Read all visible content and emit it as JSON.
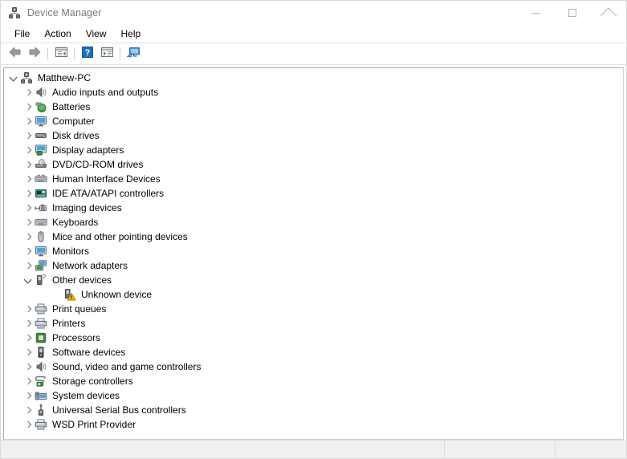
{
  "window": {
    "title": "Device Manager",
    "icon": "device-manager-icon",
    "controls": {
      "minimize": "minimize-button",
      "maximize": "maximize-button",
      "close": "close-button"
    }
  },
  "menubar": {
    "items": [
      {
        "label": "File",
        "name": "menu-file"
      },
      {
        "label": "Action",
        "name": "menu-action"
      },
      {
        "label": "View",
        "name": "menu-view"
      },
      {
        "label": "Help",
        "name": "menu-help"
      }
    ]
  },
  "toolbar": {
    "buttons": [
      {
        "name": "back-icon",
        "title": "Back"
      },
      {
        "name": "forward-icon",
        "title": "Forward"
      },
      {
        "name": "properties-icon",
        "title": "Properties"
      },
      {
        "name": "help-icon",
        "title": "Help"
      },
      {
        "name": "show-hide-console-tree-icon",
        "title": "Show/Hide Console Tree"
      },
      {
        "name": "scan-for-hardware-changes-icon",
        "title": "Scan for hardware changes"
      }
    ]
  },
  "tree": {
    "nodes": [
      {
        "label": "Matthew-PC",
        "level": 0,
        "state": "expanded",
        "icon": "computer-node-icon"
      },
      {
        "label": "Audio inputs and outputs",
        "level": 1,
        "state": "collapsed",
        "icon": "speaker-icon"
      },
      {
        "label": "Batteries",
        "level": 1,
        "state": "collapsed",
        "icon": "battery-icon"
      },
      {
        "label": "Computer",
        "level": 1,
        "state": "collapsed",
        "icon": "monitor-icon"
      },
      {
        "label": "Disk drives",
        "level": 1,
        "state": "collapsed",
        "icon": "disk-drive-icon"
      },
      {
        "label": "Display adapters",
        "level": 1,
        "state": "collapsed",
        "icon": "display-adapter-icon"
      },
      {
        "label": "DVD/CD-ROM drives",
        "level": 1,
        "state": "collapsed",
        "icon": "optical-drive-icon"
      },
      {
        "label": "Human Interface Devices",
        "level": 1,
        "state": "collapsed",
        "icon": "hid-icon"
      },
      {
        "label": "IDE ATA/ATAPI controllers",
        "level": 1,
        "state": "collapsed",
        "icon": "ide-controller-icon"
      },
      {
        "label": "Imaging devices",
        "level": 1,
        "state": "collapsed",
        "icon": "imaging-device-icon"
      },
      {
        "label": "Keyboards",
        "level": 1,
        "state": "collapsed",
        "icon": "keyboard-icon"
      },
      {
        "label": "Mice and other pointing devices",
        "level": 1,
        "state": "collapsed",
        "icon": "mouse-icon"
      },
      {
        "label": "Monitors",
        "level": 1,
        "state": "collapsed",
        "icon": "monitor-icon"
      },
      {
        "label": "Network adapters",
        "level": 1,
        "state": "collapsed",
        "icon": "network-adapter-icon"
      },
      {
        "label": "Other devices",
        "level": 1,
        "state": "expanded",
        "icon": "unknown-device-icon"
      },
      {
        "label": "Unknown device",
        "level": 2,
        "state": "leaf",
        "icon": "unknown-device-warning-icon"
      },
      {
        "label": "Print queues",
        "level": 1,
        "state": "collapsed",
        "icon": "printer-icon"
      },
      {
        "label": "Printers",
        "level": 1,
        "state": "collapsed",
        "icon": "printer-icon"
      },
      {
        "label": "Processors",
        "level": 1,
        "state": "collapsed",
        "icon": "processor-icon"
      },
      {
        "label": "Software devices",
        "level": 1,
        "state": "collapsed",
        "icon": "software-device-icon"
      },
      {
        "label": "Sound, video and game controllers",
        "level": 1,
        "state": "collapsed",
        "icon": "speaker-icon"
      },
      {
        "label": "Storage controllers",
        "level": 1,
        "state": "collapsed",
        "icon": "storage-controller-icon"
      },
      {
        "label": "System devices",
        "level": 1,
        "state": "collapsed",
        "icon": "system-device-icon"
      },
      {
        "label": "Universal Serial Bus controllers",
        "level": 1,
        "state": "collapsed",
        "icon": "usb-icon"
      },
      {
        "label": "WSD Print Provider",
        "level": 1,
        "state": "collapsed",
        "icon": "printer-icon"
      }
    ]
  },
  "statusbar": {
    "main": "",
    "pane2": "",
    "pane3": ""
  },
  "colors": {
    "accent_blue": "#1c6fb8",
    "warning_yellow": "#f2c200",
    "chrome_bg": "#ffffff",
    "status_bg": "#f0f0f0"
  }
}
